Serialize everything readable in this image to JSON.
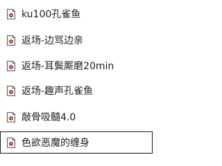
{
  "file_list": {
    "items": [
      {
        "name": "ku100孔雀鱼",
        "icon": "audio-file-icon",
        "selected": false
      },
      {
        "name": "返场-边骂边亲",
        "icon": "audio-file-icon",
        "selected": false
      },
      {
        "name": "返场-耳鬓厮磨20min",
        "icon": "audio-file-icon",
        "selected": false
      },
      {
        "name": "返场-趣声孔雀鱼",
        "icon": "audio-file-icon",
        "selected": false
      },
      {
        "name": "敲骨吸髓4.0",
        "icon": "audio-file-icon",
        "selected": false
      },
      {
        "name": "色欲恶魔的缠身",
        "icon": "audio-file-icon",
        "selected": true
      }
    ]
  },
  "colors": {
    "icon_frame": "#5a5a5a",
    "icon_dot": "#8a1f1f",
    "selection_border": "#1a1a1a"
  }
}
